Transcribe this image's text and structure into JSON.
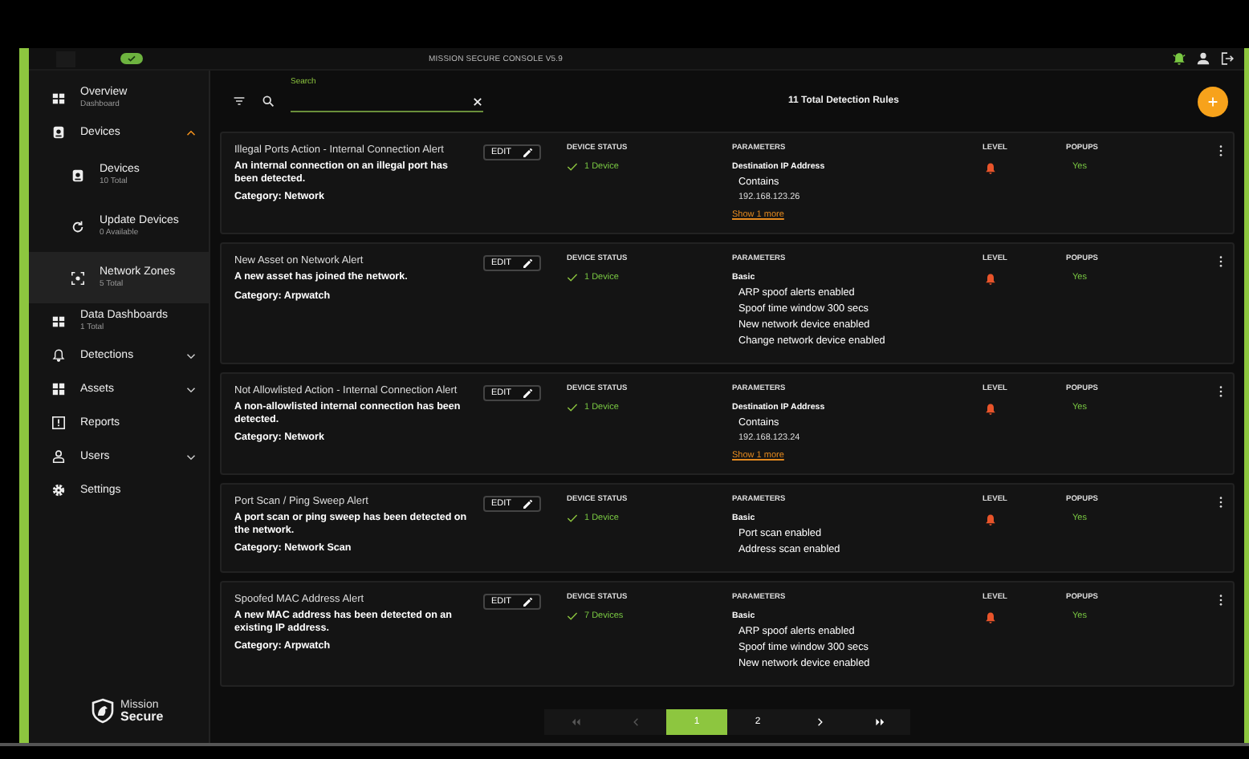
{
  "header": {
    "title": "MISSION SECURE CONSOLE V5.9"
  },
  "sidebar": {
    "items": [
      {
        "kind": "link",
        "label": "Overview",
        "sub": "Dashboard",
        "selected": false
      },
      {
        "kind": "group",
        "label": "Devices",
        "expanded": true,
        "children": [
          {
            "label": "Devices",
            "sub": "10 Total",
            "selected": false
          },
          {
            "label": "Update Devices",
            "sub": "0 Available",
            "selected": false
          },
          {
            "label": "Network Zones",
            "sub": "5 Total",
            "selected": true
          }
        ]
      },
      {
        "kind": "link",
        "label": "Data Dashboards",
        "sub": "1 Total",
        "selected": false
      },
      {
        "kind": "group",
        "label": "Detections",
        "expanded": false
      },
      {
        "kind": "group",
        "label": "Assets",
        "expanded": false
      },
      {
        "kind": "link",
        "label": "Reports",
        "selected": false
      },
      {
        "kind": "group",
        "label": "Users",
        "expanded": false
      },
      {
        "kind": "link",
        "label": "Settings",
        "selected": false
      }
    ],
    "logo": {
      "line1": "Mission",
      "line2": "Secure"
    }
  },
  "toolbar": {
    "search": {
      "label": "Search"
    },
    "count": "11 Total Detection Rules"
  },
  "rules": [
    {
      "title": "Illegal Ports Action - Internal Connection Alert",
      "description": "An internal connection on an illegal port has been detected.",
      "category": "Category: Network",
      "edit": "EDIT",
      "device_status_label": "DEVICE STATUS",
      "devices": "1 Device",
      "parameters_label": "PARAMETERS",
      "param_heading": "Destination IP Address",
      "params": [
        {
          "kind": "condition",
          "text": "Contains"
        },
        {
          "kind": "value",
          "text": "192.168.123.26"
        }
      ],
      "show_more": "Show 1 more",
      "level_label": "LEVEL",
      "popups_label": "POPUPS",
      "popups": "Yes"
    },
    {
      "title": "New Asset on Network Alert",
      "description": "A new asset has joined the network.",
      "category": "Category: Arpwatch",
      "edit": "EDIT",
      "device_status_label": "DEVICE STATUS",
      "devices": "1 Device",
      "parameters_label": "PARAMETERS",
      "param_heading": "Basic",
      "params": [
        {
          "kind": "condition",
          "text": "ARP spoof alerts enabled"
        },
        {
          "kind": "condition",
          "text": "Spoof time window 300 secs"
        },
        {
          "kind": "condition",
          "text": "New network device enabled"
        },
        {
          "kind": "condition",
          "text": "Change network device enabled"
        }
      ],
      "level_label": "LEVEL",
      "popups_label": "POPUPS",
      "popups": "Yes"
    },
    {
      "title": "Not Allowlisted Action - Internal Connection Alert",
      "description": "A non-allowlisted internal connection has been detected.",
      "category": "Category: Network",
      "edit": "EDIT",
      "device_status_label": "DEVICE STATUS",
      "devices": "1 Device",
      "parameters_label": "PARAMETERS",
      "param_heading": "Destination IP Address",
      "params": [
        {
          "kind": "condition",
          "text": "Contains"
        },
        {
          "kind": "value",
          "text": "192.168.123.24"
        }
      ],
      "show_more": "Show 1 more",
      "level_label": "LEVEL",
      "popups_label": "POPUPS",
      "popups": "Yes"
    },
    {
      "title": "Port Scan / Ping Sweep Alert",
      "description": "A port scan or ping sweep has been detected on the network.",
      "category": "Category: Network Scan",
      "edit": "EDIT",
      "device_status_label": "DEVICE STATUS",
      "devices": "1 Device",
      "parameters_label": "PARAMETERS",
      "param_heading": "Basic",
      "params": [
        {
          "kind": "condition",
          "text": "Port scan enabled"
        },
        {
          "kind": "condition",
          "text": "Address scan enabled"
        }
      ],
      "level_label": "LEVEL",
      "popups_label": "POPUPS",
      "popups": "Yes"
    },
    {
      "title": "Spoofed MAC Address Alert",
      "description": "A new MAC address has been detected on an existing IP address.",
      "category": "Category: Arpwatch",
      "edit": "EDIT",
      "device_status_label": "DEVICE STATUS",
      "devices": "7 Devices",
      "parameters_label": "PARAMETERS",
      "param_heading": "Basic",
      "params": [
        {
          "kind": "condition",
          "text": "ARP spoof alerts enabled"
        },
        {
          "kind": "condition",
          "text": "Spoof time window 300 secs"
        },
        {
          "kind": "condition",
          "text": "New network device enabled"
        }
      ],
      "level_label": "LEVEL",
      "popups_label": "POPUPS",
      "popups": "Yes"
    }
  ],
  "pagination": {
    "first_disabled": true,
    "prev_disabled": true,
    "pages": [
      {
        "label": "1",
        "selected": true
      },
      {
        "label": "2",
        "selected": false
      }
    ]
  }
}
